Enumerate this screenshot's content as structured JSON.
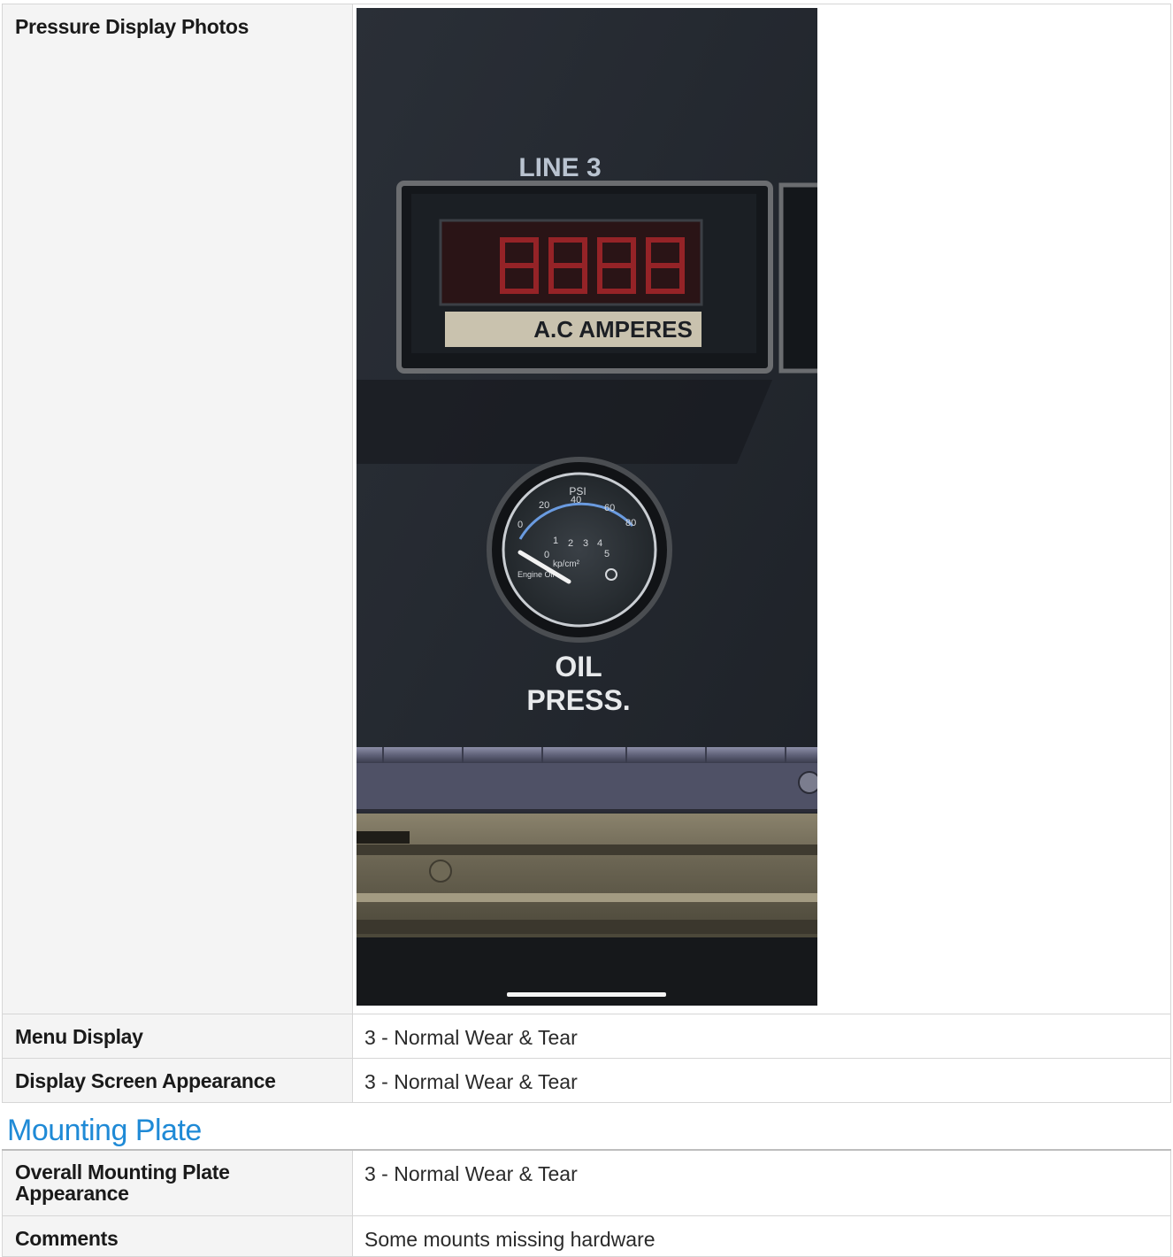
{
  "inspection": {
    "rows": [
      {
        "label": "Pressure Display Photos"
      },
      {
        "label": "Menu Display",
        "value": "3 - Normal Wear & Tear"
      },
      {
        "label": "Display Screen Appearance",
        "value": "3 - Normal Wear & Tear"
      }
    ],
    "photo": {
      "panel_top_label": "LINE 3",
      "meter_label": "A.C AMPERES",
      "gauge_label_1": "OIL",
      "gauge_label_2": "PRESS.",
      "gauge_unit_psi": "PSI",
      "gauge_unit_metric": "kp/cm²",
      "gauge_engine_text": "Engine Oil",
      "gauge_psi_ticks": [
        "0",
        "20",
        "40",
        "60",
        "80"
      ],
      "gauge_metric_ticks": [
        "0",
        "1",
        "2",
        "3",
        "4",
        "5"
      ],
      "colors": {
        "panel": "#23272e",
        "display_red": "#c8262a"
      }
    }
  },
  "mounting_plate": {
    "title": "Mounting Plate",
    "rows": [
      {
        "label": "Overall Mounting Plate Appearance",
        "value": "3 - Normal Wear & Tear"
      },
      {
        "label": "Comments",
        "value": "Some mounts missing hardware"
      }
    ]
  }
}
